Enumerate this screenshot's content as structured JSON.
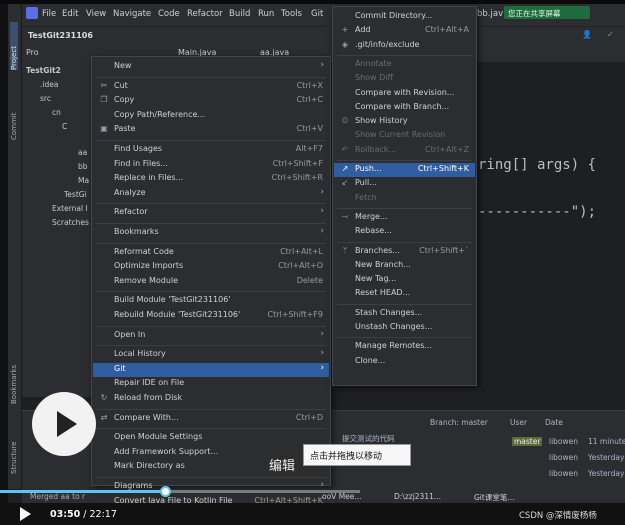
{
  "menubar": {
    "items": [
      "File",
      "Edit",
      "View",
      "Navigate",
      "Code",
      "Refactor",
      "Build",
      "Run",
      "Tools",
      "Git"
    ],
    "right_text": "bb.jav",
    "share_label": "您正在共享屏幕"
  },
  "project": {
    "name": "TestGit231106",
    "tool_label": "Pro",
    "tabs": [
      "Main.java",
      "aa.java"
    ],
    "tree": [
      "TestGit2",
      ".idea",
      "src",
      "cn",
      "C",
      "aa",
      "bb",
      "Ma",
      "TestGi",
      "External I",
      "Scratches"
    ]
  },
  "toolstrip": {
    "project": "Project",
    "commit": "Commit",
    "bookmarks": "Bookmarks",
    "structure": "Structure"
  },
  "context_menu": {
    "items": [
      {
        "label": "New",
        "shortcut": "",
        "arrow": true,
        "icon": ""
      },
      {
        "sep": true
      },
      {
        "label": "Cut",
        "shortcut": "Ctrl+X",
        "icon": "✂"
      },
      {
        "label": "Copy",
        "shortcut": "Ctrl+C",
        "icon": "❐"
      },
      {
        "label": "Copy Path/Reference...",
        "shortcut": "",
        "icon": ""
      },
      {
        "label": "Paste",
        "shortcut": "Ctrl+V",
        "icon": "▣"
      },
      {
        "sep": true
      },
      {
        "label": "Find Usages",
        "shortcut": "Alt+F7",
        "icon": ""
      },
      {
        "label": "Find in Files...",
        "shortcut": "Ctrl+Shift+F",
        "icon": ""
      },
      {
        "label": "Replace in Files...",
        "shortcut": "Ctrl+Shift+R",
        "icon": ""
      },
      {
        "label": "Analyze",
        "shortcut": "",
        "arrow": true,
        "icon": ""
      },
      {
        "sep": true
      },
      {
        "label": "Refactor",
        "shortcut": "",
        "arrow": true,
        "icon": ""
      },
      {
        "sep": true
      },
      {
        "label": "Bookmarks",
        "shortcut": "",
        "arrow": true,
        "icon": ""
      },
      {
        "sep": true
      },
      {
        "label": "Reformat Code",
        "shortcut": "Ctrl+Alt+L",
        "icon": ""
      },
      {
        "label": "Optimize Imports",
        "shortcut": "Ctrl+Alt+O",
        "icon": ""
      },
      {
        "label": "Remove Module",
        "shortcut": "Delete",
        "icon": ""
      },
      {
        "sep": true
      },
      {
        "label": "Build Module 'TestGit231106'",
        "shortcut": "",
        "icon": ""
      },
      {
        "label": "Rebuild Module 'TestGit231106'",
        "shortcut": "Ctrl+Shift+F9",
        "icon": ""
      },
      {
        "sep": true
      },
      {
        "label": "Open In",
        "shortcut": "",
        "arrow": true,
        "icon": ""
      },
      {
        "sep": true
      },
      {
        "label": "Local History",
        "shortcut": "",
        "arrow": true,
        "icon": ""
      },
      {
        "label": "Git",
        "shortcut": "",
        "arrow": true,
        "icon": "",
        "highlight": true
      },
      {
        "label": "Repair IDE on File",
        "shortcut": "",
        "icon": ""
      },
      {
        "label": "Reload from Disk",
        "shortcut": "",
        "icon": "↻"
      },
      {
        "sep": true
      },
      {
        "label": "Compare With...",
        "shortcut": "Ctrl+D",
        "icon": "⇄"
      },
      {
        "sep": true
      },
      {
        "label": "Open Module Settings",
        "shortcut": "",
        "icon": ""
      },
      {
        "label": "Add Framework Support...",
        "shortcut": "",
        "icon": ""
      },
      {
        "label": "Mark Directory as",
        "shortcut": "",
        "arrow": true,
        "icon": ""
      },
      {
        "sep": true
      },
      {
        "label": "Diagrams",
        "shortcut": "",
        "arrow": true,
        "icon": ""
      },
      {
        "label": "Convert Java File to Kotlin File",
        "shortcut": "Ctrl+Alt+Shift+K",
        "icon": ""
      }
    ]
  },
  "git_submenu": {
    "items": [
      {
        "label": "Commit Directory...",
        "shortcut": "",
        "icon": ""
      },
      {
        "label": "Add",
        "shortcut": "Ctrl+Alt+A",
        "icon": "+"
      },
      {
        "label": ".git/info/exclude",
        "shortcut": "",
        "icon": "◈"
      },
      {
        "sep": true
      },
      {
        "label": "Annotate",
        "shortcut": "",
        "icon": "",
        "disabled": true
      },
      {
        "label": "Show Diff",
        "shortcut": "",
        "icon": "",
        "disabled": true
      },
      {
        "label": "Compare with Revision...",
        "shortcut": "",
        "icon": ""
      },
      {
        "label": "Compare with Branch...",
        "shortcut": "",
        "icon": ""
      },
      {
        "label": "Show History",
        "shortcut": "",
        "icon": "⏲"
      },
      {
        "label": "Show Current Revision",
        "shortcut": "",
        "icon": "",
        "disabled": true
      },
      {
        "label": "Rollback...",
        "shortcut": "Ctrl+Alt+Z",
        "icon": "↶",
        "disabled": true
      },
      {
        "sep": true
      },
      {
        "label": "Push...",
        "shortcut": "Ctrl+Shift+K",
        "icon": "↗",
        "highlight": true
      },
      {
        "label": "Pull...",
        "shortcut": "",
        "icon": "↙"
      },
      {
        "label": "Fetch",
        "shortcut": "",
        "icon": "",
        "disabled": true
      },
      {
        "sep": true
      },
      {
        "label": "Merge...",
        "shortcut": "",
        "icon": "⤙"
      },
      {
        "label": "Rebase...",
        "shortcut": "",
        "icon": ""
      },
      {
        "sep": true
      },
      {
        "label": "Branches...",
        "shortcut": "Ctrl+Shift+`",
        "icon": "ᛘ"
      },
      {
        "label": "New Branch...",
        "shortcut": "",
        "icon": ""
      },
      {
        "label": "New Tag...",
        "shortcut": "",
        "icon": ""
      },
      {
        "label": "Reset HEAD...",
        "shortcut": "",
        "icon": ""
      },
      {
        "sep": true
      },
      {
        "label": "Stash Changes...",
        "shortcut": "",
        "icon": ""
      },
      {
        "label": "Unstash Changes...",
        "shortcut": "",
        "icon": ""
      },
      {
        "sep": true
      },
      {
        "label": "Manage Remotes...",
        "shortcut": "",
        "icon": ""
      },
      {
        "label": "Clone...",
        "shortcut": "",
        "icon": ""
      }
    ]
  },
  "editor": {
    "line1": "ring[] args) {",
    "line2": "-----------\");"
  },
  "git_log": {
    "branch_label": "Branch: master",
    "user_label": "User",
    "date_label": "Date",
    "rows": [
      {
        "msg": "提交测试的代码",
        "branch": "master",
        "author": "libowen",
        "date": "11 minute"
      },
      {
        "msg": "",
        "branch": "",
        "author": "libowen",
        "date": "Yesterday"
      },
      {
        "msg": "",
        "branch": "",
        "author": "libowen",
        "date": "Yesterday"
      }
    ]
  },
  "status": {
    "merged": "Merged aa to r",
    "taskbar": [
      "ooV Mee...",
      "D:\\zzj2311...",
      "Git课堂笔..."
    ]
  },
  "overlay": {
    "tooltip": "点击并拖拽以移动",
    "edit_label": "编辑",
    "current_time": "03:50",
    "separator": "/",
    "total_time": "22:17",
    "progress": 0.172,
    "watermark": "CSDN @深情废杨杨"
  },
  "colors": {
    "highlight": "#2f5da0",
    "accent_progress": "#5ac6f0"
  }
}
